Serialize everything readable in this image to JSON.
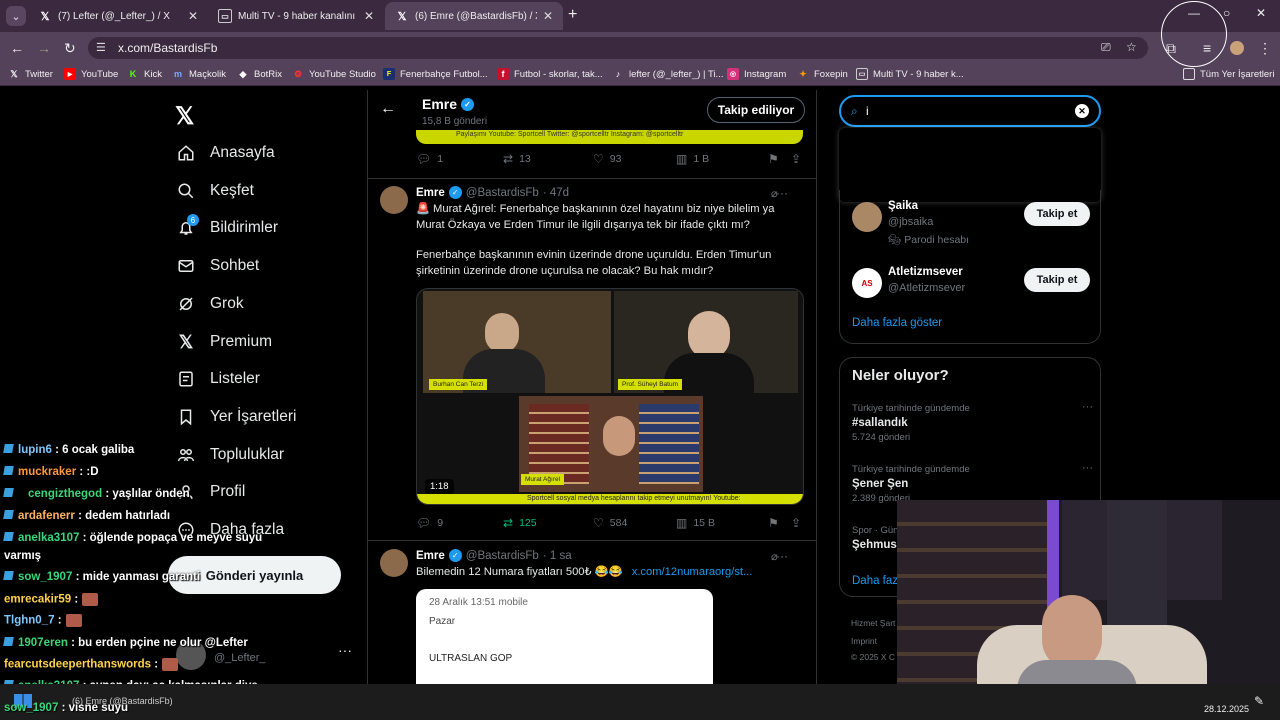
{
  "browser": {
    "tabs": [
      {
        "title": "(7) Lefter (@_Lefter_) / X",
        "icon": "x-logo-icon"
      },
      {
        "title": "Multi TV - 9 haber kanalını aynı",
        "icon": "multitv-icon"
      },
      {
        "title": "(6) Emre (@BastardisFb) / X",
        "icon": "x-logo-icon"
      }
    ],
    "url": "x.com/BastardisFb",
    "bookmarks": [
      {
        "label": "Twitter",
        "icon": "x-logo-icon"
      },
      {
        "label": "YouTube",
        "icon": "youtube-icon"
      },
      {
        "label": "Kick",
        "icon": "kick-icon"
      },
      {
        "label": "Maçkolik",
        "icon": "mackolik-icon"
      },
      {
        "label": "BotRix",
        "icon": "botrix-icon"
      },
      {
        "label": "YouTube Studio",
        "icon": "youtube-studio-icon"
      },
      {
        "label": "Fenerbahçe Futbol...",
        "icon": "fenerbahce-icon"
      },
      {
        "label": "Futbol - skorlar, tak...",
        "icon": "flashscore-icon"
      },
      {
        "label": "lefter (@_lefter_) | Ti...",
        "icon": "tiktok-icon"
      },
      {
        "label": "Instagram",
        "icon": "instagram-icon"
      },
      {
        "label": "Foxepin",
        "icon": "foxepin-icon"
      },
      {
        "label": "Multi TV - 9 haber k...",
        "icon": "multitv-icon"
      }
    ],
    "all_bookmarks": "Tüm Yer İşaretleri"
  },
  "nav": {
    "items": [
      {
        "label": "Anasayfa",
        "icon": "home-icon"
      },
      {
        "label": "Keşfet",
        "icon": "search-icon"
      },
      {
        "label": "Bildirimler",
        "icon": "bell-icon",
        "badge": "6"
      },
      {
        "label": "Sohbet",
        "icon": "mail-icon"
      },
      {
        "label": "Grok",
        "icon": "grok-icon"
      },
      {
        "label": "Premium",
        "icon": "x-logo-icon"
      },
      {
        "label": "Listeler",
        "icon": "list-icon"
      },
      {
        "label": "Yer İşaretleri",
        "icon": "bookmark-icon"
      },
      {
        "label": "Topluluklar",
        "icon": "communities-icon"
      },
      {
        "label": "Profil",
        "icon": "profile-icon"
      },
      {
        "label": "Daha fazla",
        "icon": "more-icon"
      }
    ],
    "post_button": "Gönderi yayınla",
    "bottom_handle": "@_Lefter_"
  },
  "profile": {
    "name": "Emre",
    "post_count": "15,8 B gönderi",
    "follow_state": "Takip ediliyor",
    "pinned_strip": "Paylaşımı Youtube: Sportcell Twitter: @sportcelltr Instagram: @sportcelltr",
    "pinned_actions": {
      "replies": "1",
      "retweets": "13",
      "likes": "93",
      "views": "1 B"
    }
  },
  "tweets": [
    {
      "name": "Emre",
      "handle": "@BastardisFb",
      "time": "· 47d",
      "lines": [
        "🚨 Murat Ağırel: Fenerbahçe başkanının özel hayatını biz niye bilelim ya",
        "Murat Özkaya ve Erden Timur ile ilgili dışarıya tek bir ifade çıktı mı?",
        "",
        "Fenerbahçe başkanının evinin üzerinde drone uçuruldu. Erden Timur'un",
        "şirketinin üzerinde drone uçurulsa ne olacak? Bu hak mıdır?"
      ],
      "video": {
        "duration": "1:18",
        "guests": [
          "Burhan Can Terzi",
          "Prof. Süheyl Batum",
          "Murat Ağırel"
        ],
        "strip": "Sportcell sosyal medya hesaplarını takip etmeyi unutmayın! Youtube:"
      },
      "actions": {
        "replies": "9",
        "retweets": "125",
        "likes": "584",
        "views": "15 B"
      }
    },
    {
      "name": "Emre",
      "handle": "@BastardisFb",
      "time": "· 1 sa",
      "text": "Bilemedin 12 Numara fiyatları 500₺ 😂😂",
      "link": "x.com/12numaraorg/st...",
      "receipt": [
        "28 Aralık 13:51 mobile",
        "Pazar",
        "ULTRASLAN GOP"
      ]
    }
  ],
  "search": {
    "value": "i"
  },
  "suggestions": [
    {
      "name": "Şaika",
      "handle": "@jbsaika",
      "label": "Parodi hesabı",
      "button": "Takip et"
    },
    {
      "name": "Atletizmsever",
      "handle": "@Atletizmsever",
      "button": "Takip et"
    }
  ],
  "show_more": "Daha fazla göster",
  "trends": {
    "title": "Neler oluyor?",
    "items": [
      {
        "context": "Türkiye tarihinde gündemde",
        "title": "#sallandık",
        "count": "5.724 gönderi"
      },
      {
        "context": "Türkiye tarihinde gündemde",
        "title": "Şener Şen",
        "count": "2.389 gönderi"
      },
      {
        "context": "Spor · Gün",
        "title": "Şehmus"
      }
    ],
    "show_more": "Daha faz"
  },
  "footer": [
    "Hizmet Şart",
    "Imprint",
    "© 2025 X C"
  ],
  "chat": [
    {
      "user": "lupin6",
      "color": "#7ec8ff",
      "msg": ": 6 ocak galiba"
    },
    {
      "user": "muckraker",
      "color": "#ff9a3c",
      "msg": ": :D"
    },
    {
      "user": "cengizthegod",
      "color": "#3cd67a",
      "msg": ": yaşlılar önden"
    },
    {
      "user": "ardafenerr",
      "color": "#ffb060",
      "msg": ": dedem hatırladı"
    },
    {
      "user": "anelka3107",
      "color": "#3cd67a",
      "msg": ": öğlende popaça ve meyve suyu"
    },
    {
      "user": "",
      "color": "#fff",
      "msg": "varmış"
    },
    {
      "user": "sow_1907",
      "color": "#3cd67a",
      "msg": ": mide yanması garanti"
    },
    {
      "user": "emrecakir59",
      "color": "#ffd24a",
      "msg": ":"
    },
    {
      "user": "Tlghn0_7",
      "color": "#7ec8ff",
      "msg": ":"
    },
    {
      "user": "1907eren",
      "color": "#3cd67a",
      "msg": ": bu erden pçine ne olur"
    },
    {
      "user": "fearcutsdeeperthanswords",
      "color": "#ffd24a",
      "msg": ":"
    },
    {
      "user": "anelka3107",
      "color": "#3cd67a",
      "msg": ": aynen dayı aç kalmasınlar diye"
    },
    {
      "user": "sow_1907",
      "color": "#3cd67a",
      "msg": ": visne suyu"
    }
  ],
  "overlay_name": "@Lefter",
  "taskbar": {
    "date": "28.12.2025",
    "window": "(6) Emre (@BastardisFb)"
  },
  "colors": {
    "accent": "#1d9bf0",
    "chrome": "#3b2a3f",
    "toolbar": "#54415a"
  }
}
